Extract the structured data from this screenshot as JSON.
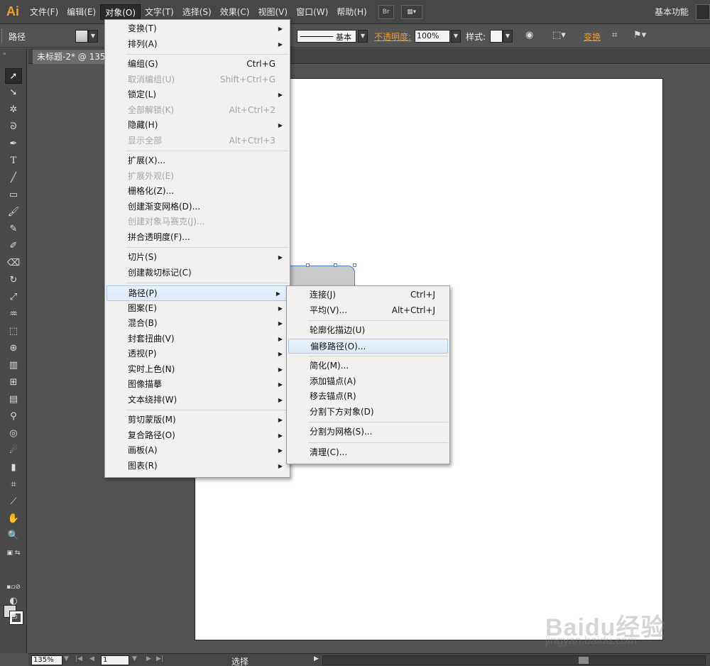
{
  "app": {
    "logo": "Ai",
    "workspace": "基本功能"
  },
  "menubar": [
    {
      "label": "文件(F)"
    },
    {
      "label": "编辑(E)"
    },
    {
      "label": "对象(O)"
    },
    {
      "label": "文字(T)"
    },
    {
      "label": "选择(S)"
    },
    {
      "label": "效果(C)"
    },
    {
      "label": "视图(V)"
    },
    {
      "label": "窗口(W)"
    },
    {
      "label": "帮助(H)"
    }
  ],
  "menubar_extra": {
    "bridge_label": "Br"
  },
  "control": {
    "label": "路径",
    "stroke_style": "基本",
    "opacity_label": "不透明度:",
    "opacity_value": "100%",
    "style_label": "样式:",
    "transform_link": "变换"
  },
  "document": {
    "tab": "未标题-2* @ 135%"
  },
  "object_menu": {
    "groups": [
      [
        {
          "label": "变换(T)",
          "submenu": true
        },
        {
          "label": "排列(A)",
          "submenu": true
        }
      ],
      [
        {
          "label": "编组(G)",
          "shortcut": "Ctrl+G"
        },
        {
          "label": "取消编组(U)",
          "shortcut": "Shift+Ctrl+G",
          "disabled": true
        },
        {
          "label": "锁定(L)",
          "submenu": true
        },
        {
          "label": "全部解锁(K)",
          "shortcut": "Alt+Ctrl+2",
          "disabled": true
        },
        {
          "label": "隐藏(H)",
          "submenu": true
        },
        {
          "label": "显示全部",
          "shortcut": "Alt+Ctrl+3",
          "disabled": true
        }
      ],
      [
        {
          "label": "扩展(X)..."
        },
        {
          "label": "扩展外观(E)",
          "disabled": true
        },
        {
          "label": "栅格化(Z)..."
        },
        {
          "label": "创建渐变网格(D)..."
        },
        {
          "label": "创建对象马赛克(J)...",
          "disabled": true
        },
        {
          "label": "拼合透明度(F)..."
        }
      ],
      [
        {
          "label": "切片(S)",
          "submenu": true
        },
        {
          "label": "创建裁切标记(C)"
        }
      ],
      [
        {
          "label": "路径(P)",
          "submenu": true,
          "highlight": true
        },
        {
          "label": "图案(E)",
          "submenu": true
        },
        {
          "label": "混合(B)",
          "submenu": true
        },
        {
          "label": "封套扭曲(V)",
          "submenu": true
        },
        {
          "label": "透视(P)",
          "submenu": true
        },
        {
          "label": "实时上色(N)",
          "submenu": true
        },
        {
          "label": "图像描摹",
          "submenu": true
        },
        {
          "label": "文本绕排(W)",
          "submenu": true
        }
      ],
      [
        {
          "label": "剪切蒙版(M)",
          "submenu": true
        },
        {
          "label": "复合路径(O)",
          "submenu": true
        },
        {
          "label": "画板(A)",
          "submenu": true
        },
        {
          "label": "图表(R)",
          "submenu": true
        }
      ]
    ]
  },
  "path_submenu": {
    "groups": [
      [
        {
          "label": "连接(J)",
          "shortcut": "Ctrl+J"
        },
        {
          "label": "平均(V)...",
          "shortcut": "Alt+Ctrl+J"
        }
      ],
      [
        {
          "label": "轮廓化描边(U)"
        },
        {
          "label": "偏移路径(O)...",
          "highlight": true
        }
      ],
      [
        {
          "label": "简化(M)..."
        },
        {
          "label": "添加锚点(A)"
        },
        {
          "label": "移去锚点(R)"
        },
        {
          "label": "分割下方对象(D)"
        }
      ],
      [
        {
          "label": "分割为网格(S)..."
        }
      ],
      [
        {
          "label": "清理(C)..."
        }
      ]
    ]
  },
  "status": {
    "zoom": "135%",
    "page": "1",
    "mode": "选择"
  },
  "watermark": {
    "text": "Baidu经验",
    "sub": "jingyan.baidu.com"
  }
}
